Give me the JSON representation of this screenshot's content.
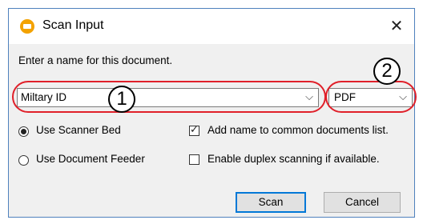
{
  "window": {
    "title": "Scan Input",
    "close_label": "✕"
  },
  "instruction": "Enter a name for this document.",
  "name_combo": {
    "value": "Miltary ID",
    "chevron": "⌵"
  },
  "type_combo": {
    "value": "PDF",
    "chevron": "⌵"
  },
  "annotations": {
    "badge_1": "1",
    "badge_2": "2",
    "highlight_color": "#e0202a"
  },
  "source_options": [
    {
      "label": "Use Scanner Bed",
      "selected": true
    },
    {
      "label": "Use Document Feeder",
      "selected": false
    }
  ],
  "checkboxes": [
    {
      "label": "Add name to common documents list.",
      "checked": true
    },
    {
      "label": "Enable duplex scanning if available.",
      "checked": false
    }
  ],
  "buttons": {
    "scan": "Scan",
    "cancel": "Cancel"
  },
  "icons": {
    "app": "scanner-app-icon",
    "close": "close-icon"
  },
  "colors": {
    "accent": "#0078d7",
    "app_icon": "#f3a200"
  }
}
